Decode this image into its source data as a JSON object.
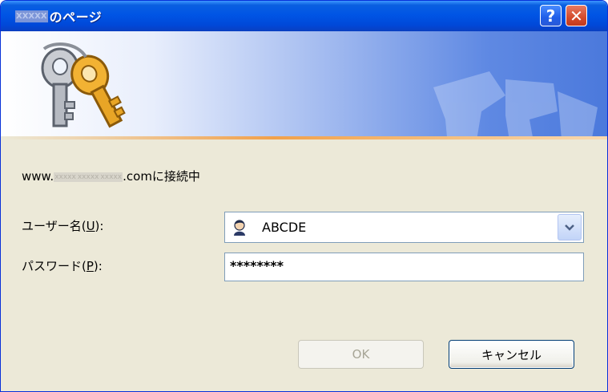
{
  "window": {
    "title_masked": "XXXXX",
    "title_suffix": "のページ",
    "help_glyph": "?",
    "close_glyph": "✕"
  },
  "dialog": {
    "connection_prefix": "www.",
    "connection_mask1": "xxxxx",
    "connection_mask2": "xxxxx",
    "connection_mask3": "xxxxx",
    "connection_suffix": ".comに接続中",
    "username_label_pre": "ユーザー名(",
    "username_label_key": "U",
    "username_label_post": "):",
    "username_value": "ABCDE",
    "password_label_pre": "パスワード(",
    "password_label_key": "P",
    "password_label_post": "):",
    "password_value": "********",
    "ok_label": "OK",
    "cancel_label": "キャンセル"
  },
  "colors": {
    "title_bar": "#0055e5",
    "dialog_bg": "#ece9d8",
    "accent_line": "#f2a14b",
    "close_button": "#d44b2c"
  },
  "icons": {
    "banner": "keys-icon",
    "user": "user-icon",
    "dropdown": "chevron-down-icon"
  }
}
